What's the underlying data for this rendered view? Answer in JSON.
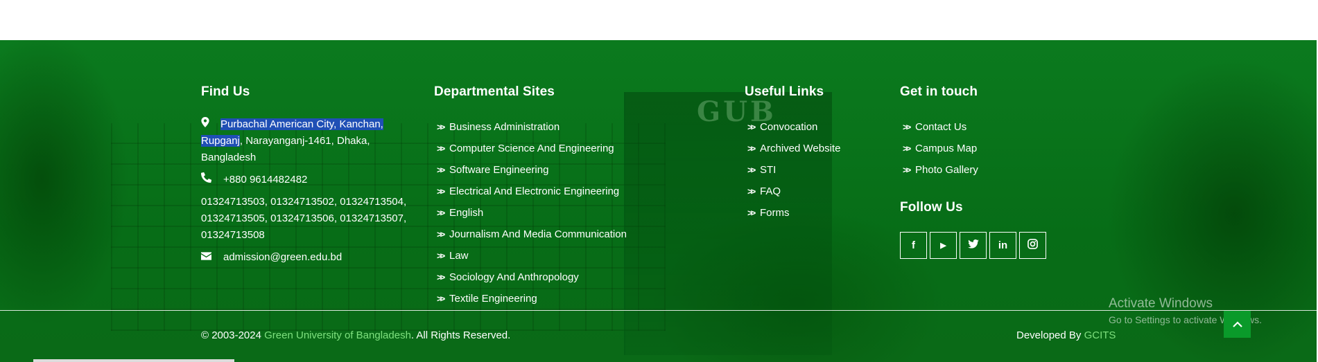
{
  "find_us": {
    "title": "Find Us",
    "address_highlight": "Purbachal American City, Kanchan, Rupganj",
    "address_rest": ", Narayanganj-1461, Dhaka, Bangladesh",
    "phone": "+880 9614482482",
    "mobiles": "01324713503, 01324713502, 01324713504, 01324713505, 01324713506, 01324713507, 01324713508",
    "email": "admission@green.edu.bd"
  },
  "departmental": {
    "title": "Departmental Sites",
    "items": [
      "Business Administration",
      "Computer Science And Engineering",
      "Software Engineering",
      "Electrical And Electronic Engineering",
      "English",
      "Journalism And Media Communication",
      "Law",
      "Sociology And Anthropology",
      "Textile Engineering"
    ]
  },
  "useful": {
    "title": "Useful Links",
    "items": [
      "Convocation",
      "Archived Website",
      "STI",
      "FAQ",
      "Forms"
    ]
  },
  "touch": {
    "title": "Get in touch",
    "items": [
      "Contact Us",
      "Campus Map",
      "Photo Gallery"
    ],
    "follow_title": "Follow Us",
    "social": [
      {
        "icon": "facebook-icon",
        "glyph": "f"
      },
      {
        "icon": "youtube-icon",
        "glyph": "▶"
      },
      {
        "icon": "twitter-icon",
        "glyph": "🐦"
      },
      {
        "icon": "linkedin-icon",
        "glyph": "in"
      },
      {
        "icon": "instagram-icon",
        "glyph": "◎"
      }
    ]
  },
  "building_sign": "GUB",
  "bottom": {
    "copyright_prefix": "© 2003-2024 ",
    "university": "Green University of Bangladesh",
    "copyright_suffix": ". All Rights Reserved.",
    "developed_prefix": "Developed By ",
    "developer": "GCITS"
  },
  "activate": {
    "title": "Activate Windows",
    "subtitle": "Go to Settings to activate Windows."
  },
  "colors": {
    "footer_green": "#0b7a1e",
    "brand_link": "#7ee07e",
    "scroll_button": "#0a9a2a",
    "highlight": "#1f4fb5"
  }
}
